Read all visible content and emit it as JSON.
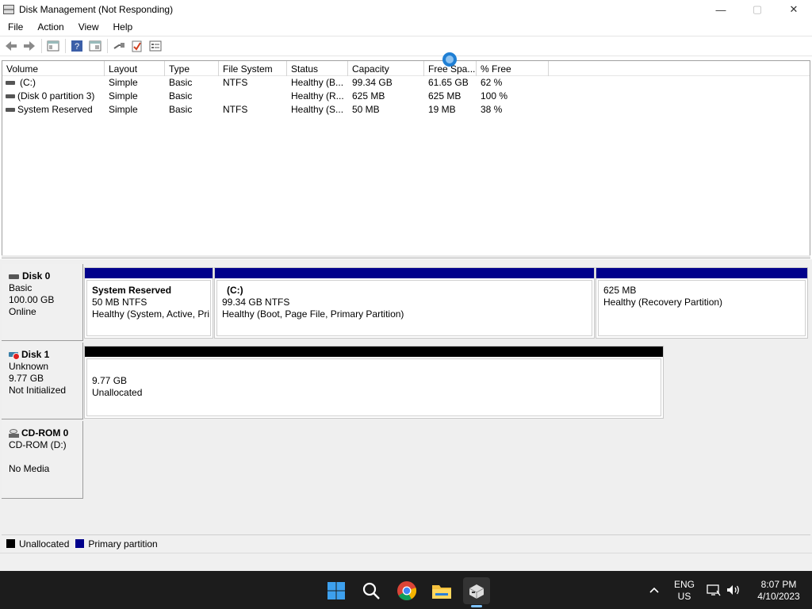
{
  "window": {
    "title": "Disk Management (Not Responding)",
    "controls": {
      "minimize": "—",
      "maximize": "▢",
      "close": "✕"
    }
  },
  "menu": [
    "File",
    "Action",
    "View",
    "Help"
  ],
  "toolbar": {
    "buttons": [
      "back-icon",
      "forward-icon",
      "console-tree-icon",
      "help-icon",
      "properties-icon",
      "connect-icon",
      "check-icon",
      "settings-panel-icon"
    ]
  },
  "volume_list": {
    "columns": [
      "Volume",
      "Layout",
      "Type",
      "File System",
      "Status",
      "Capacity",
      "Free Spa...",
      "% Free"
    ],
    "rows": [
      {
        "volume": "(C:)",
        "layout": "Simple",
        "type": "Basic",
        "fs": "NTFS",
        "status": "Healthy (B...",
        "capacity": "99.34 GB",
        "free": "61.65 GB",
        "pct": "62 %"
      },
      {
        "volume": "(Disk 0 partition 3)",
        "layout": "Simple",
        "type": "Basic",
        "fs": "",
        "status": "Healthy (R...",
        "capacity": "625 MB",
        "free": "625 MB",
        "pct": "100 %"
      },
      {
        "volume": "System Reserved",
        "layout": "Simple",
        "type": "Basic",
        "fs": "NTFS",
        "status": "Healthy (S...",
        "capacity": "50 MB",
        "free": "19 MB",
        "pct": "38 %"
      }
    ]
  },
  "disks": [
    {
      "name": "Disk 0",
      "type": "Basic",
      "size": "100.00 GB",
      "state": "Online",
      "partitions": [
        {
          "name": "System Reserved",
          "size": "50 MB NTFS",
          "status": "Healthy (System, Active, Pri"
        },
        {
          "name": "(C:)",
          "size": "99.34 GB NTFS",
          "status": "Healthy (Boot, Page File, Primary Partition)"
        },
        {
          "name": "",
          "size": "625 MB",
          "status": "Healthy (Recovery Partition)"
        }
      ]
    },
    {
      "name": "Disk 1",
      "type": "Unknown",
      "size": "9.77 GB",
      "state": "Not Initialized",
      "partitions": [
        {
          "size": "9.77 GB",
          "status": "Unallocated"
        }
      ]
    },
    {
      "name": "CD-ROM 0",
      "type": "CD-ROM (D:)",
      "state": "No Media"
    }
  ],
  "legend": [
    {
      "label": "Unallocated",
      "color": "#000000"
    },
    {
      "label": "Primary partition",
      "color": "#00008b"
    }
  ],
  "colors": {
    "primary": "#00008b",
    "unallocated": "#000000",
    "taskbar": "#1c1c1c"
  },
  "taskbar": {
    "apps": [
      "windows-start-icon",
      "search-icon",
      "chrome-icon",
      "file-explorer-icon",
      "disk-management-icon"
    ],
    "language": "ENG",
    "region": "US",
    "time": "8:07 PM",
    "date": "4/10/2023"
  }
}
